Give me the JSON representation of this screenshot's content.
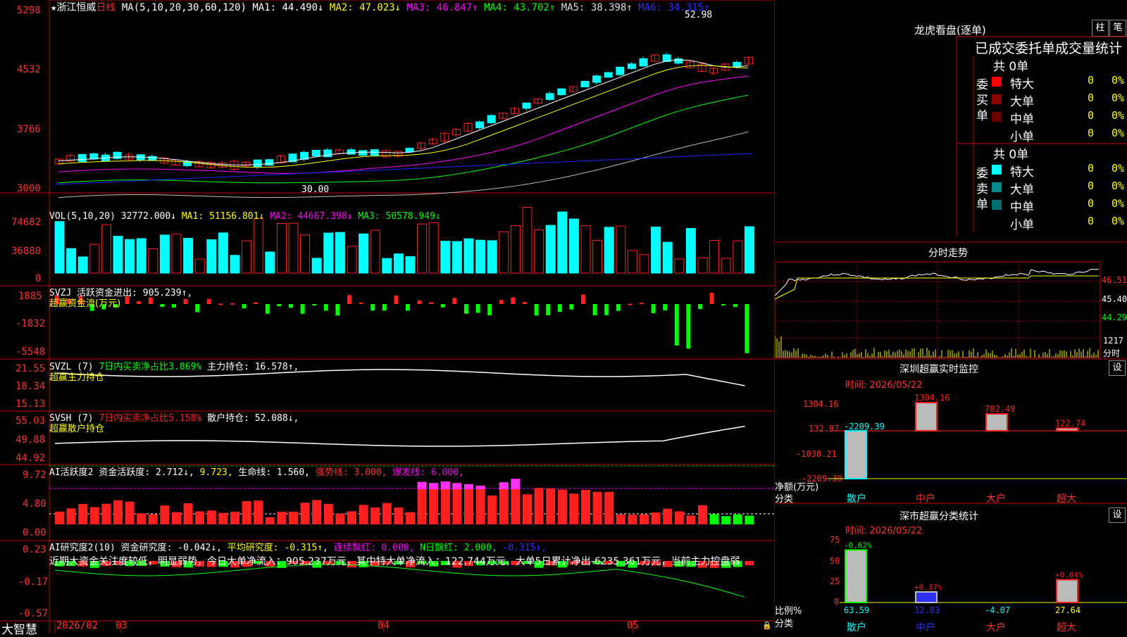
{
  "app": {
    "brand": "大智慧"
  },
  "chart_header": {
    "star": "★",
    "name": "浙江恒威",
    "period": "日线",
    "ma_label": "MA(5,10,20,30,60,120)",
    "ma1": "MA1: 44.490↓",
    "ma2": "MA2: 47.023↓",
    "ma3": "MA3: 46.847↑",
    "ma4": "MA4: 43.702↑",
    "ma5": "MA5: 38.398↑",
    "ma6": "MA6: 34.315↑",
    "high_marker": "52.98",
    "low_marker": "30.00"
  },
  "colors": {
    "up": "#ff2020",
    "down": "#00ffff",
    "grid": "#c00000",
    "ma1": "#ffffff",
    "ma2": "#ffff00",
    "ma3": "#ff00ff",
    "ma4": "#00ff00",
    "ma5": "#bbbbbb",
    "ma6": "#2020ff"
  },
  "price_axis": [
    "5298",
    "4532",
    "3766",
    "3000"
  ],
  "vol_panel": {
    "label": "VOL(5,10,20)",
    "v": "32772.000↓",
    "ma1": "MA1: 51156.801↓",
    "ma2": "MA2: 44667.398↓",
    "ma3": "MA3: 50578.949↓",
    "axis": [
      "74682",
      "36880",
      "0"
    ]
  },
  "svzj_panel": {
    "label": "SVZJ  活跃资金进出: 905.239↑,",
    "sub": "超赢资金流(万元)",
    "axis": [
      "1885",
      "-1832",
      "-5548"
    ]
  },
  "svzl_panel": {
    "label": "SVZL  (7)",
    "a": "7日内买卖净占比3.869%",
    "b": "主力持仓: 16.578↑,",
    "sub": "超赢主力持仓",
    "axis": [
      "21.55",
      "18.34",
      "15.13"
    ]
  },
  "svsh_panel": {
    "label": "SVSH  (7)",
    "a": "7日内买卖净占比5.158%",
    "b": "散户持仓: 52.088↓,",
    "sub": "超赢散户持仓",
    "axis": [
      "55.03",
      "49.88",
      "44.92"
    ]
  },
  "ai1_panel": {
    "label": "AI活跃度2",
    "b": "资金活跃度: 2.712↓,",
    "c": "9.723,",
    "d": "生命线: 1.560,",
    "e": "强势线: 3.000,",
    "f": "爆发线: 6.000,",
    "axis": [
      "9.72",
      "4.80",
      "0.00"
    ]
  },
  "ai2_panel": {
    "label": "AI研究度2(10)",
    "b": "资金研究度: -0.042↓,",
    "c": "平均研究度: -0.315↑,",
    "d": "连续飘红: 0.000,",
    "e": "N日飘红: 2.000,",
    "f": "-0.315↑,",
    "note": "近期大资金关注度较低，明显弱势，今日大单净流入：905.237万元，其中特大单净流入：122.744万元，大单5日累计净出-6235.361万元，当前主力控盘弱",
    "axis": [
      "0.23",
      "-0.17",
      "-0.57"
    ]
  },
  "date_axis": [
    "2026/02",
    "03",
    "04",
    "05"
  ],
  "dragon": {
    "title": "龙虎看盘(逐单)",
    "btn1": "柱",
    "btn2": "笔",
    "subtitle": "已成交委托单成交量统计",
    "buy_group": "委买单",
    "sell_group": "委卖单",
    "buy_total": "共 0单",
    "sell_total": "共 0单",
    "buy_rows": [
      {
        "name": "特大",
        "n": "0",
        "p": "0%",
        "color": "#ff0000"
      },
      {
        "name": "大单",
        "n": "0",
        "p": "0%",
        "color": "#8b0000"
      },
      {
        "name": "中单",
        "n": "0",
        "p": "0%",
        "color": "#6a0000"
      },
      {
        "name": "小单",
        "n": "0",
        "p": "0%",
        "color": "#000000"
      }
    ],
    "sell_rows": [
      {
        "name": "特大",
        "n": "0",
        "p": "0%",
        "color": "#00ffff"
      },
      {
        "name": "大单",
        "n": "0",
        "p": "0%",
        "color": "#008b8b"
      },
      {
        "name": "中单",
        "n": "0",
        "p": "0%",
        "color": "#007070"
      },
      {
        "name": "小单",
        "n": "0",
        "p": "0%",
        "color": "#000000"
      }
    ]
  },
  "minute": {
    "title": "分时走势",
    "axis": [
      "46.51",
      "45.40",
      "44.29"
    ],
    "vol_label": "1217",
    "fen": "分时"
  },
  "monitor": {
    "title": "深圳超赢实时监控",
    "set": "设",
    "time": "时间: 2026/05/22",
    "axis": [
      "1304.16",
      "132.97",
      "-1038.21",
      "-2209.39"
    ],
    "ylabel": "净额(万元)",
    "xlabel": "分类",
    "cats": [
      "散户",
      "中户",
      "大户",
      "超大"
    ]
  },
  "classify": {
    "title": "深市超赢分类统计",
    "set": "设",
    "time": "时间: 2026/05/22",
    "axis": [
      "75",
      "50",
      "25",
      "0"
    ],
    "ylabel": "比例%",
    "xlabel": "分类",
    "cats": [
      "散户",
      "中户",
      "大户",
      "超大"
    ]
  },
  "chart_data": [
    {
      "type": "bar",
      "title": "深圳超赢实时监控",
      "categories": [
        "散户",
        "中户",
        "大户",
        "超大"
      ],
      "values": [
        -2209.39,
        1304.16,
        782.49,
        122.74
      ],
      "xlabel": "分类",
      "ylabel": "净额(万元)",
      "ylim": [
        -2209.39,
        1304.16
      ]
    },
    {
      "type": "bar",
      "title": "深市超赢分类统计",
      "categories": [
        "散户",
        "中户",
        "大户",
        "超大"
      ],
      "values": [
        63.59,
        12.83,
        -4.07,
        27.64
      ],
      "change": [
        "-0.62%",
        "+0.37%",
        "",
        "+0.04%"
      ],
      "xlabel": "分类",
      "ylabel": "比例%",
      "ylim": [
        0,
        75
      ]
    }
  ]
}
